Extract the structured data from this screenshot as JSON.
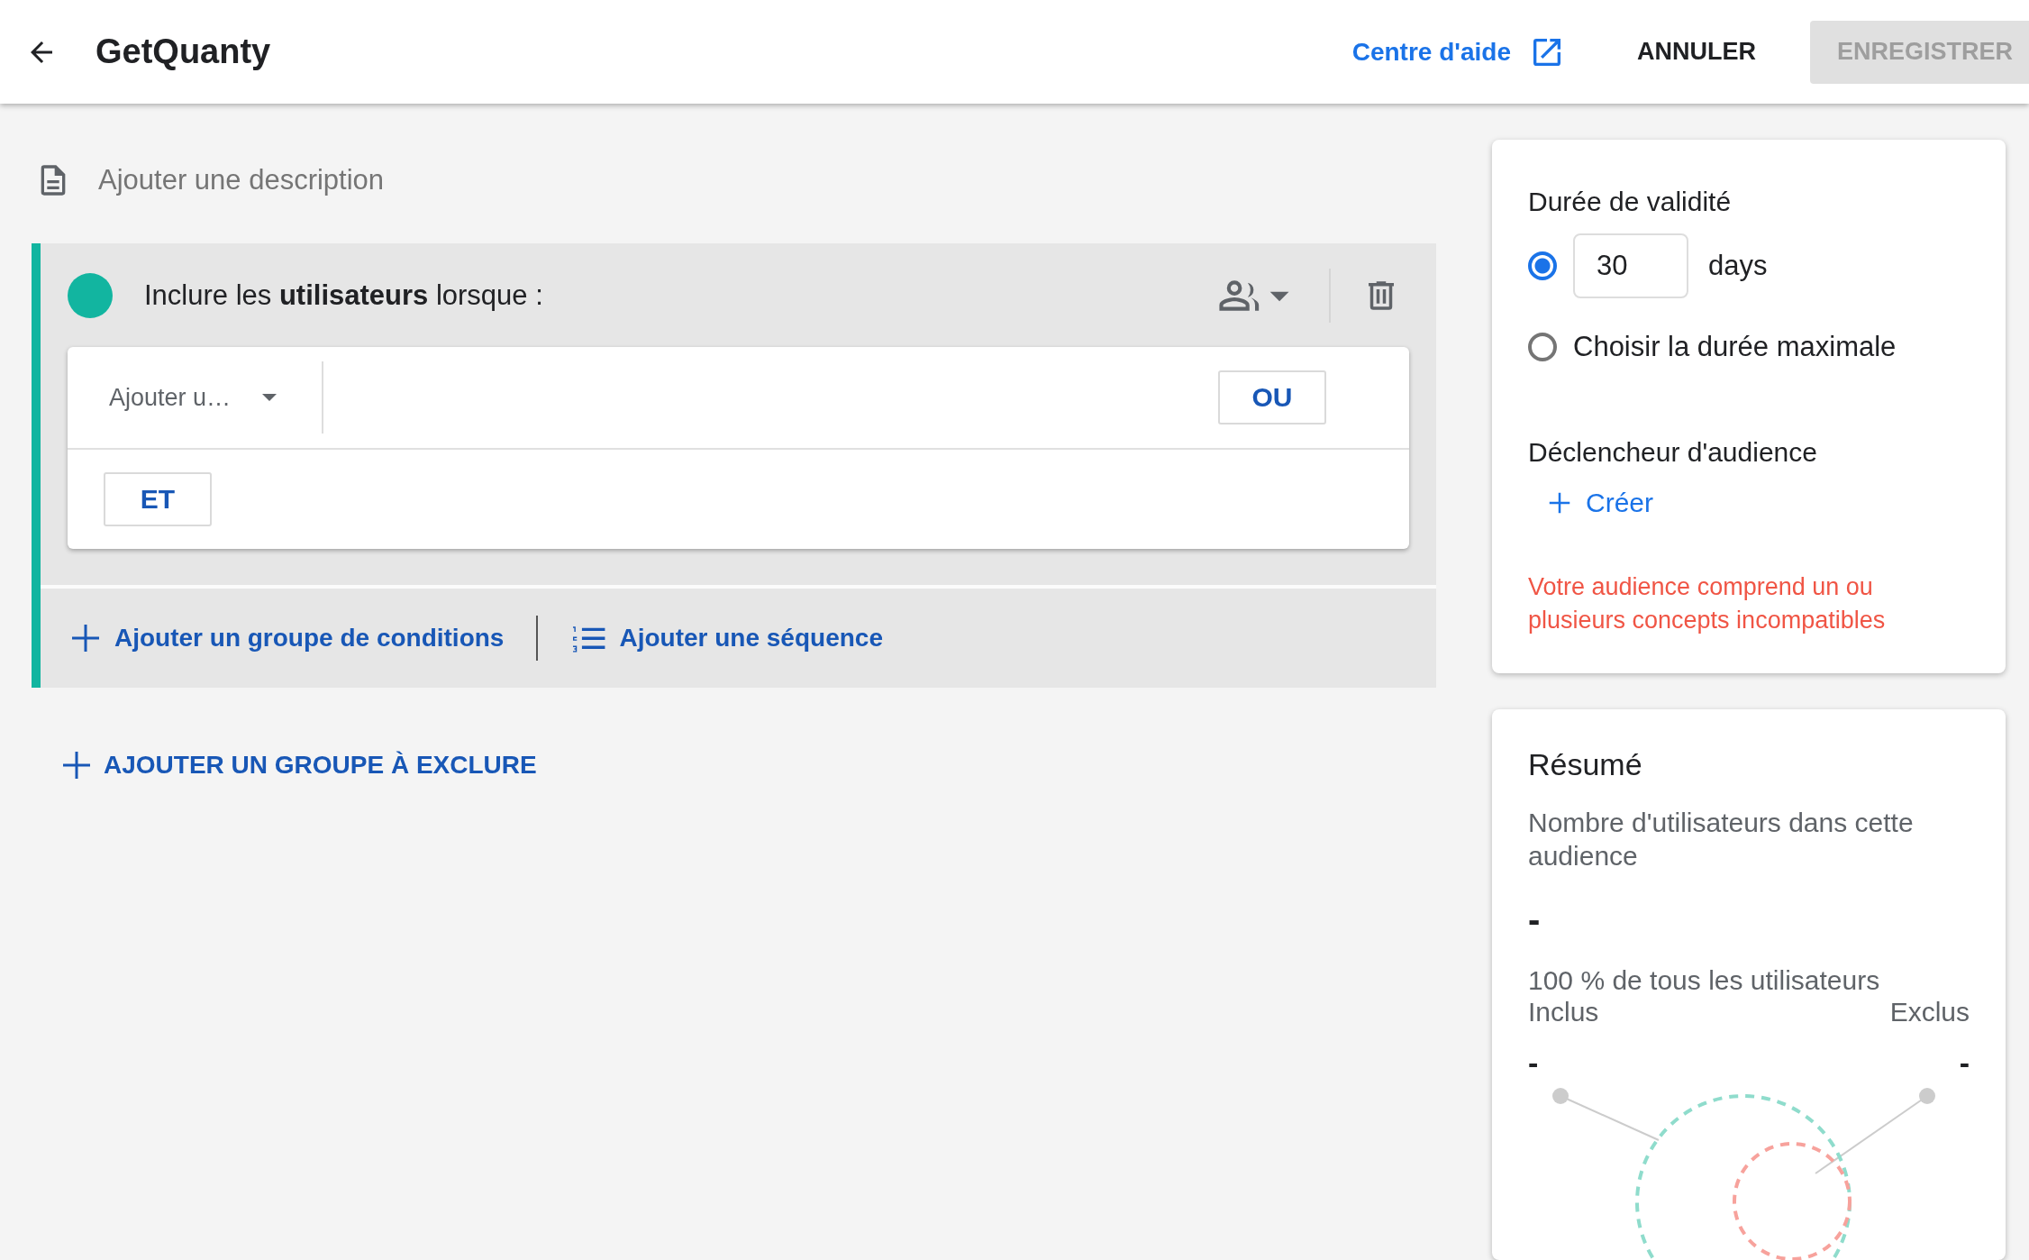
{
  "header": {
    "title": "GetQuanty",
    "help_link": "Centre d'aide",
    "cancel": "ANNULER",
    "save": {
      "label": "ENREGISTRER",
      "disabled": true
    }
  },
  "description_placeholder": "Ajouter une description",
  "include_group": {
    "title": "Inclure les **utilisateurs** lorsque :",
    "condition_dropdown": "Ajouter u…",
    "or_button": "OU",
    "and_button": "ET",
    "add_condition_group": "Ajouter un groupe de conditions",
    "add_sequence": "Ajouter une séquence"
  },
  "add_exclude_group": "AJOUTER UN GROUPE À EXCLURE",
  "validity": {
    "title": "Durée de validité",
    "options": [
      {
        "kind": "days",
        "selected": true,
        "value": "30",
        "unit": "days"
      },
      {
        "kind": "label",
        "selected": false,
        "label": "Choisir la durée maximale"
      }
    ]
  },
  "trigger": {
    "title": "Déclencheur d'audience",
    "create": "Créer"
  },
  "warning": "Votre audience comprend un ou plusieurs concepts incompatibles",
  "summary": {
    "title": "Résumé",
    "subtitle": "Nombre d'utilisateurs dans cette audience",
    "count": "-",
    "share": "100 % de tous les utilisateurs",
    "included": {
      "label": "Inclus",
      "value": "-"
    },
    "excluded": {
      "label": "Exclus",
      "value": "-"
    }
  }
}
